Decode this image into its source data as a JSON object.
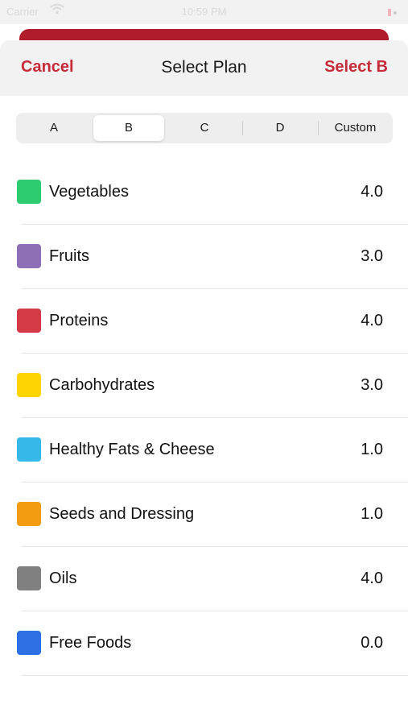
{
  "status_bar": {
    "carrier": "Carrier",
    "time": "10:59 PM"
  },
  "header": {
    "cancel_label": "Cancel",
    "title": "Select Plan",
    "select_label": "Select B"
  },
  "segments": {
    "options": [
      "A",
      "B",
      "C",
      "D",
      "Custom"
    ],
    "selected": "B"
  },
  "plan_items": [
    {
      "label": "Vegetables",
      "value": "4.0",
      "color": "#2ecc71"
    },
    {
      "label": "Fruits",
      "value": "3.0",
      "color": "#8e6fb5"
    },
    {
      "label": "Proteins",
      "value": "4.0",
      "color": "#d33a45"
    },
    {
      "label": "Carbohydrates",
      "value": "3.0",
      "color": "#ffd400"
    },
    {
      "label": "Healthy Fats & Cheese",
      "value": "1.0",
      "color": "#36b9e9"
    },
    {
      "label": "Seeds and Dressing",
      "value": "1.0",
      "color": "#f39c12"
    },
    {
      "label": "Oils",
      "value": "4.0",
      "color": "#808080"
    },
    {
      "label": "Free Foods",
      "value": "0.0",
      "color": "#2f6fe4"
    }
  ],
  "colors": {
    "accent": "#c62b3a",
    "header_bg": "#f2f2f2",
    "segment_bg": "#eeeeef"
  },
  "icons": {
    "wifi": "wifi-icon",
    "battery": "battery-icon"
  }
}
